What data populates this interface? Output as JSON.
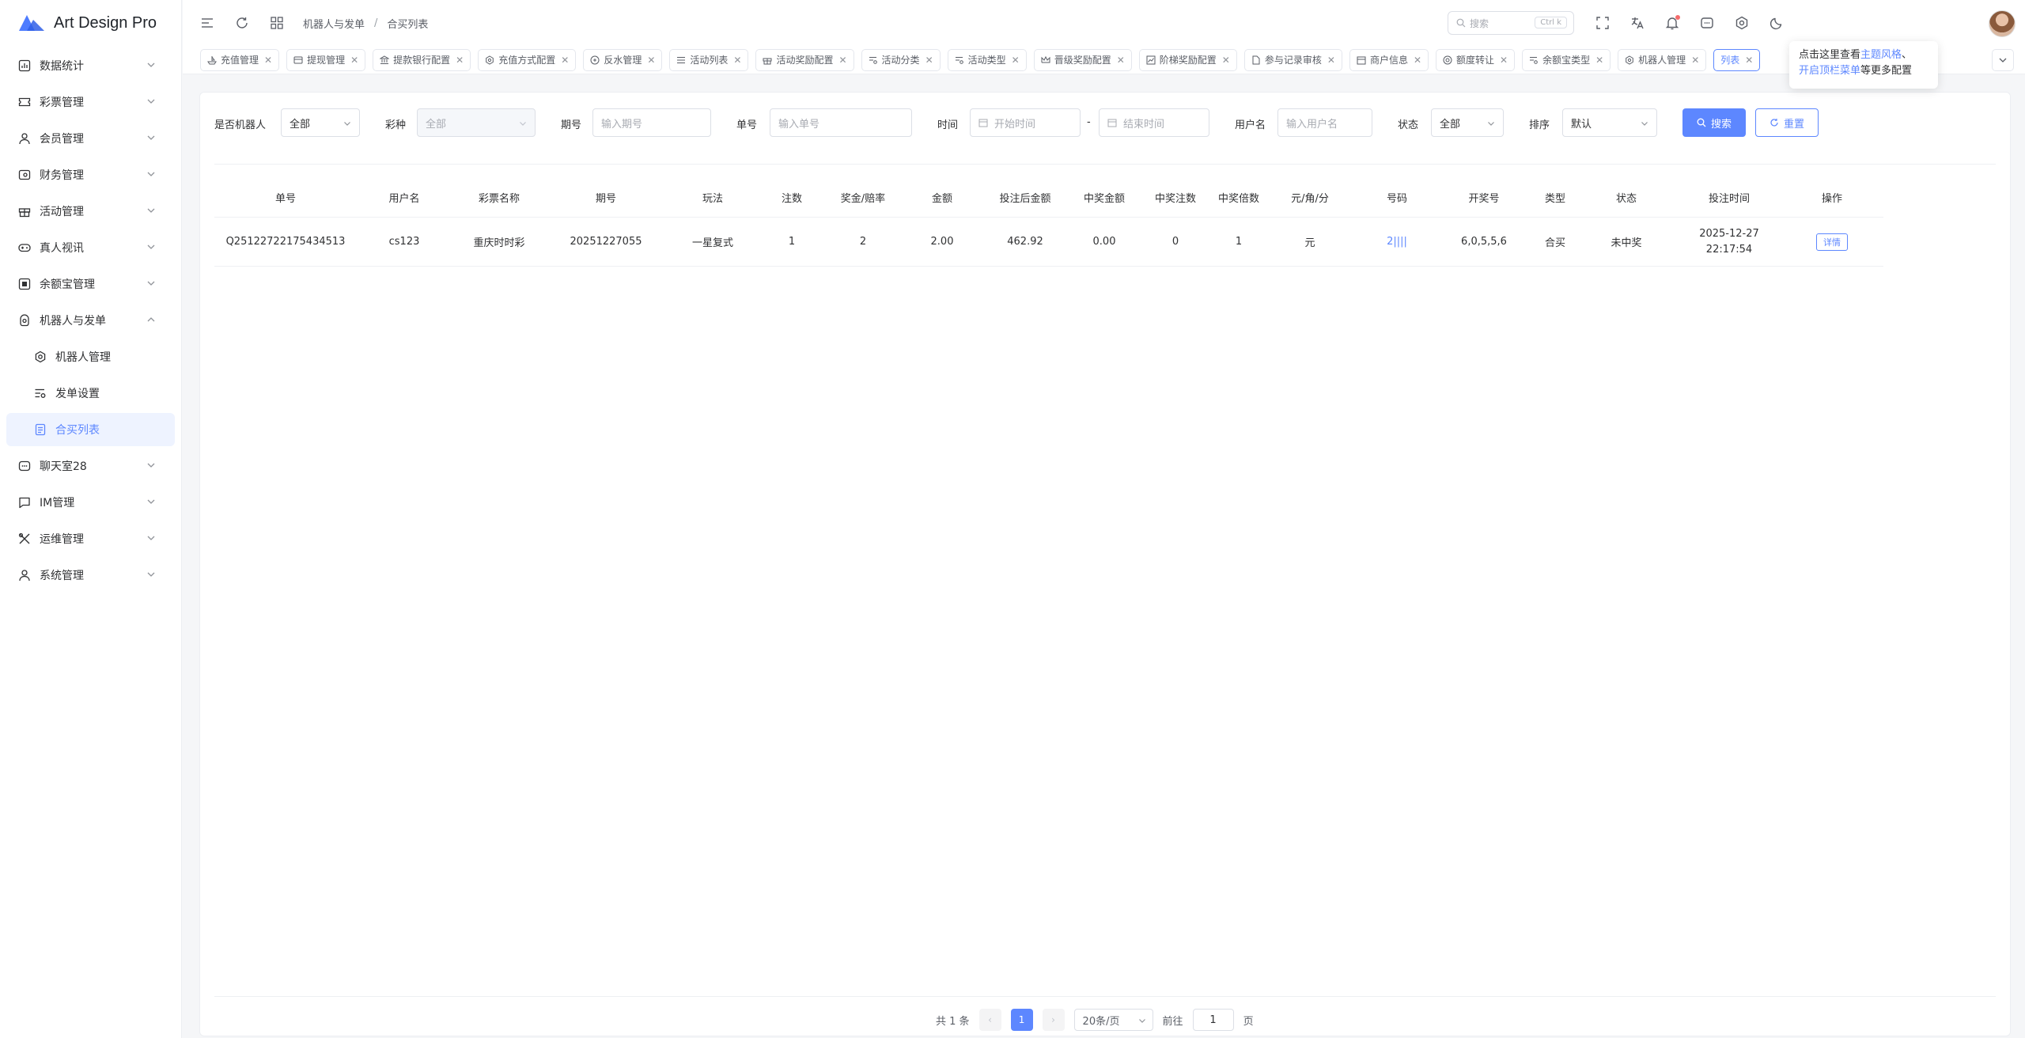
{
  "app": {
    "title": "Art Design Pro"
  },
  "sidebar": {
    "items": [
      {
        "label": "数据统计",
        "icon": "chart-icon"
      },
      {
        "label": "彩票管理",
        "icon": "ticket-icon"
      },
      {
        "label": "会员管理",
        "icon": "user-icon"
      },
      {
        "label": "财务管理",
        "icon": "wallet-icon"
      },
      {
        "label": "活动管理",
        "icon": "gift-icon"
      },
      {
        "label": "真人视讯",
        "icon": "gamepad-icon"
      },
      {
        "label": "余额宝管理",
        "icon": "safe-icon"
      },
      {
        "label": "机器人与发单",
        "icon": "robot-icon"
      },
      {
        "label": "机器人管理",
        "icon": "gear-icon"
      },
      {
        "label": "发单设置",
        "icon": "list-settings-icon"
      },
      {
        "label": "合买列表",
        "icon": "document-icon"
      },
      {
        "label": "聊天室28",
        "icon": "chat-box-icon"
      },
      {
        "label": "IM管理",
        "icon": "message-icon"
      },
      {
        "label": "运维管理",
        "icon": "tools-icon"
      },
      {
        "label": "系统管理",
        "icon": "user-icon"
      }
    ]
  },
  "topbar": {
    "breadcrumb": [
      "机器人与发单",
      "合买列表"
    ],
    "search_placeholder": "搜索",
    "search_shortcut": "Ctrl k"
  },
  "tabs": [
    {
      "label": "充值管理"
    },
    {
      "label": "提现管理"
    },
    {
      "label": "提款银行配置"
    },
    {
      "label": "充值方式配置"
    },
    {
      "label": "反水管理"
    },
    {
      "label": "活动列表"
    },
    {
      "label": "活动奖励配置"
    },
    {
      "label": "活动分类"
    },
    {
      "label": "活动类型"
    },
    {
      "label": "晋级奖励配置"
    },
    {
      "label": "阶梯奖励配置"
    },
    {
      "label": "参与记录审核"
    },
    {
      "label": "商户信息"
    },
    {
      "label": "额度转让"
    },
    {
      "label": "余额宝类型"
    },
    {
      "label": "机器人管理"
    },
    {
      "label": "列表"
    }
  ],
  "tooltip": {
    "line1_prefix": "点击这里查看",
    "line1_link": "主题风格",
    "line1_suffix": "、",
    "line2_link": "开启顶栏菜单",
    "line2_suffix": "等更多配置"
  },
  "filters": {
    "robot_label": "是否机器人",
    "robot_value": "全部",
    "lottery_label": "彩种",
    "lottery_value": "全部",
    "period_label": "期号",
    "period_placeholder": "输入期号",
    "order_label": "单号",
    "order_placeholder": "输入单号",
    "time_label": "时间",
    "start_placeholder": "开始时间",
    "time_sep": "-",
    "end_placeholder": "结束时间",
    "username_label": "用户名",
    "username_placeholder": "输入用户名",
    "status_label": "状态",
    "status_value": "全部",
    "sort_label": "排序",
    "sort_value": "默认",
    "search_button": "搜索",
    "reset_button": "重置"
  },
  "table": {
    "columns": [
      "单号",
      "用户名",
      "彩票名称",
      "期号",
      "玩法",
      "注数",
      "奖金/赔率",
      "金额",
      "投注后金额",
      "中奖金额",
      "中奖注数",
      "中奖倍数",
      "元/角/分",
      "号码",
      "开奖号",
      "类型",
      "状态",
      "投注时间",
      "操作"
    ],
    "rows": [
      {
        "order_no": "Q25122722175434513",
        "username": "cs123",
        "lottery": "重庆时时彩",
        "period": "20251227055",
        "play": "一星复式",
        "bets": "1",
        "odds": "2",
        "amount": "2.00",
        "after_amount": "462.92",
        "win_amount": "0.00",
        "win_bets": "0",
        "win_multiple": "1",
        "unit": "元",
        "numbers": "2||||",
        "draw_no": "6,0,5,5,6",
        "type": "合买",
        "status": "未中奖",
        "time_date": "2025-12-27",
        "time_clock": "22:17:54",
        "action": "详情"
      }
    ]
  },
  "pagination": {
    "total": "共 1 条",
    "prev": "‹",
    "current": "1",
    "next": "›",
    "page_size": "20条/页",
    "goto_prefix": "前往",
    "goto_value": "1",
    "goto_suffix": "页"
  },
  "colors": {
    "accent": "#5d87ff",
    "danger": "#f56c6c"
  }
}
